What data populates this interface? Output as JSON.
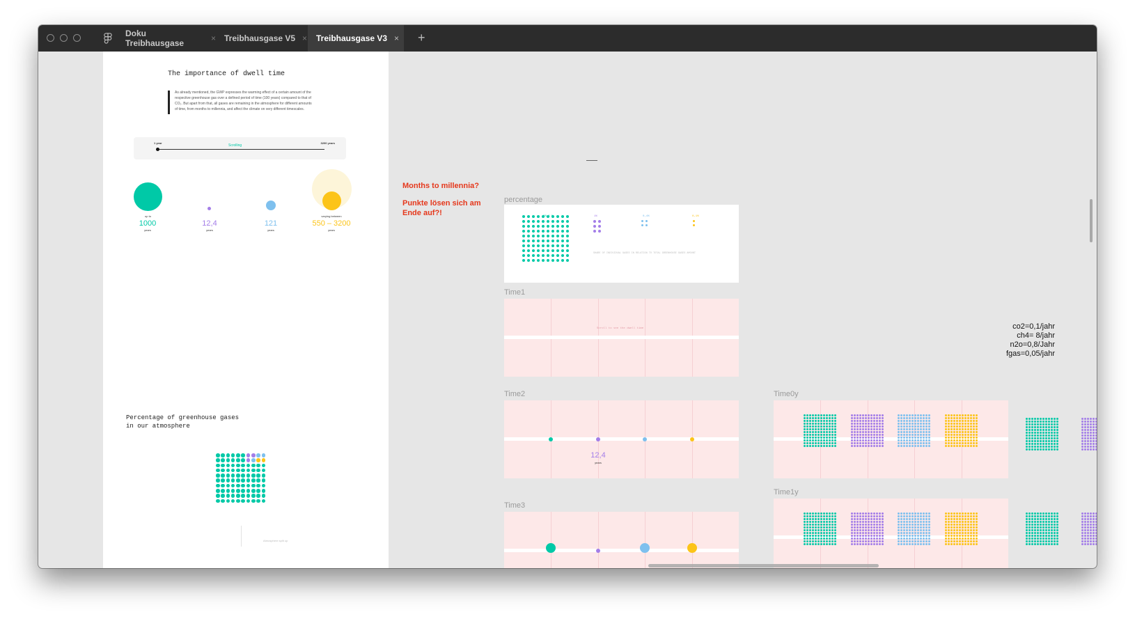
{
  "window": {
    "tabs": [
      {
        "label": "Doku Treibhausgase",
        "active": false
      },
      {
        "label": "Treibhausgase V5",
        "active": false
      },
      {
        "label": "Treibhausgase V3",
        "active": true
      }
    ],
    "close_glyph": "×",
    "new_tab_glyph": "+"
  },
  "colors": {
    "co2": "#00c9a7",
    "ch4": "#a47ee8",
    "n2o": "#7ec0ee",
    "fgas": "#fcc419",
    "note_red": "#e5381c",
    "pink_frame": "#fde8e8"
  },
  "dwell": {
    "heading": "The importance of dwell time",
    "body": "As already mentioned, the GWP expresses the warming effect of a certain amount of the respective greenhouse gas over a defined period of time (100 years) compared to that of CO₂. But apart from that, all gases are remaining in the atmosphere for different amounts of time, from months to millennia, and affect the climate on very different timescales.",
    "slider": {
      "start": "1 year",
      "end": "3200 years",
      "label": "Scrolling"
    },
    "gases": [
      {
        "id": "co2",
        "prefix": "up to",
        "value": "1000",
        "unit": "years"
      },
      {
        "id": "ch4",
        "prefix": "",
        "value": "12,4",
        "unit": "years"
      },
      {
        "id": "n2o",
        "prefix": "",
        "value": "121",
        "unit": "years"
      },
      {
        "id": "fgas",
        "prefix": "varying between",
        "value": "550 – 3200",
        "unit": "years"
      }
    ]
  },
  "percentage_section": {
    "heading_line1": "Percentage of greenhouse gases",
    "heading_line2": "in our atmosphere",
    "footer": "Atmosphere split up"
  },
  "notes": {
    "months": "Months to millennia?",
    "punkte_line1": "Punkte lösen sich am",
    "punkte_line2": "Ende auf?!"
  },
  "frames": {
    "percentage": {
      "label": "percentage",
      "caption": "SHARE OF INDIVIDUAL GASES IN RELATION TO TOTAL GREENHOUSE GASES AMOUNT",
      "values": [
        "98,5 %",
        "1%",
        "0,4%",
        "0,1%"
      ]
    },
    "time1": {
      "label": "Time1",
      "hint": "Scroll to see the dwell time"
    },
    "time2": {
      "label": "Time2",
      "value": "12,4",
      "unit": "years"
    },
    "time3": {
      "label": "Time3"
    },
    "time0y": {
      "label": "Time0y"
    },
    "time1y": {
      "label": "Time1y"
    }
  },
  "rates": {
    "co2": "co2=0,1/jahr",
    "ch4": "ch4= 8/jahr",
    "n2o": "n2o=0,8/Jahr",
    "fgas": "fgas=0,05/jahr"
  }
}
